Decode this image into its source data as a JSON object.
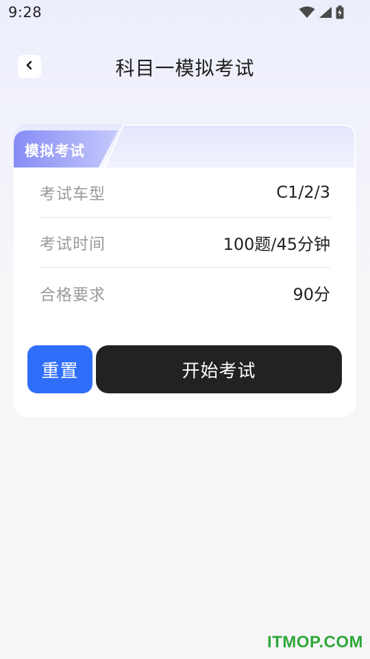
{
  "status_bar": {
    "time": "9:28",
    "icons": [
      "wifi-icon",
      "cell-signal-icon",
      "battery-charging-icon"
    ]
  },
  "header": {
    "back_icon": "chevron-left-icon",
    "title": "科目一模拟考试"
  },
  "card": {
    "tag": "模拟考试",
    "rows": [
      {
        "label": "考试车型",
        "value": "C1/2/3"
      },
      {
        "label": "考试时间",
        "value": "100题/45分钟"
      },
      {
        "label": "合格要求",
        "value": "90分"
      }
    ],
    "reset_label": "重置",
    "start_label": "开始考试"
  },
  "colors": {
    "accent_blue": "#2f6ef8",
    "primary_dark": "#222222",
    "tag_gradient_start": "#8b91f7",
    "tag_gradient_end": "#c9ccfb"
  },
  "watermark": "ITMOP.COM"
}
